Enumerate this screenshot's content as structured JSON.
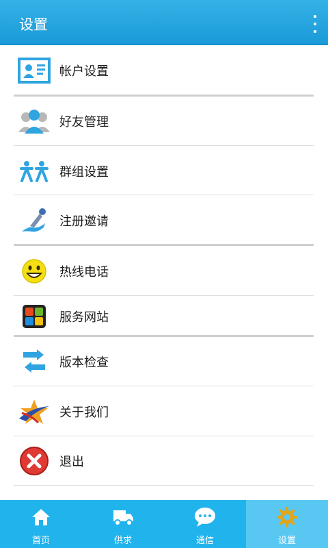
{
  "header": {
    "title": "设置"
  },
  "settings_items": [
    {
      "label": "帐户设置",
      "icon": "account-card-icon"
    },
    {
      "label": "好友管理",
      "icon": "friends-icon"
    },
    {
      "label": "群组设置",
      "icon": "group-icon"
    },
    {
      "label": "注册邀请",
      "icon": "invite-icon"
    },
    {
      "label": "热线电话",
      "icon": "smiley-icon"
    },
    {
      "label": "服务网站",
      "icon": "windows-icon"
    },
    {
      "label": "版本检查",
      "icon": "arrows-icon"
    },
    {
      "label": "关于我们",
      "icon": "star-logo-icon"
    },
    {
      "label": "退出",
      "icon": "exit-icon"
    }
  ],
  "tabs": [
    {
      "label": "首页",
      "icon": "home-icon"
    },
    {
      "label": "供求",
      "icon": "truck-icon"
    },
    {
      "label": "通信",
      "icon": "chat-icon"
    },
    {
      "label": "设置",
      "icon": "gear-icon",
      "active": true
    }
  ],
  "colors": {
    "titlebar": "#1a9ad8",
    "tabbar": "#21b3ec",
    "active_tab": "#58c8f3",
    "icon_blue": "#2fa4e0"
  }
}
